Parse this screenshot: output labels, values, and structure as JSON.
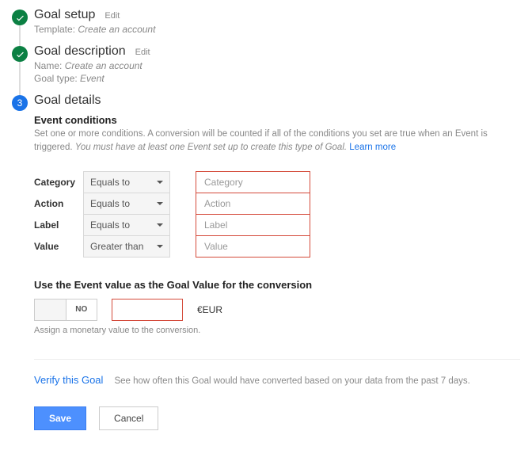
{
  "steps": {
    "setup": {
      "title": "Goal setup",
      "edit": "Edit",
      "template_label": "Template:",
      "template_value": "Create an account"
    },
    "description": {
      "title": "Goal description",
      "edit": "Edit",
      "name_label": "Name:",
      "name_value": "Create an account",
      "type_label": "Goal type:",
      "type_value": "Event"
    },
    "details": {
      "number": "3",
      "title": "Goal details"
    }
  },
  "event_conditions": {
    "heading": "Event conditions",
    "desc_plain": "Set one or more conditions. A conversion will be counted if all of the conditions you set are true when an Event is triggered. ",
    "desc_italic": "You must have at least one Event set up to create this type of Goal.",
    "learn_more": "Learn more",
    "rows": [
      {
        "label": "Category",
        "op": "Equals to",
        "placeholder": "Category"
      },
      {
        "label": "Action",
        "op": "Equals to",
        "placeholder": "Action"
      },
      {
        "label": "Label",
        "op": "Equals to",
        "placeholder": "Label"
      },
      {
        "label": "Value",
        "op": "Greater than",
        "placeholder": "Value"
      }
    ]
  },
  "goal_value": {
    "heading": "Use the Event value as the Goal Value for the conversion",
    "toggle_no": "NO",
    "currency": "€EUR",
    "hint": "Assign a monetary value to the conversion."
  },
  "verify": {
    "link": "Verify this Goal",
    "desc": "See how often this Goal would have converted based on your data from the past 7 days."
  },
  "buttons": {
    "save": "Save",
    "cancel": "Cancel"
  }
}
